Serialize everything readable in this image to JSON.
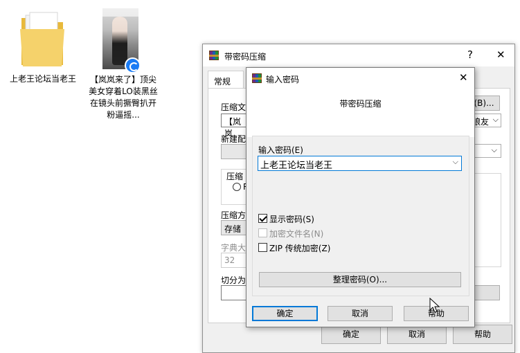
{
  "desktop": {
    "icons": [
      {
        "label": "上老王论坛当老王",
        "type": "folder"
      },
      {
        "label": "【岚岚来了】顶尖美女穿着LO装黑丝在镜头前撅臀扒开粉逼摇...",
        "type": "video"
      }
    ]
  },
  "back_dialog": {
    "title": "带密码压缩",
    "help_btn": "?",
    "close_btn": "✕",
    "tab_general": "常规",
    "archive_name_label": "压缩文",
    "archive_name_value": "【岚岚",
    "browse_btn": "(B)...",
    "format_value": "狼友",
    "new_profile_label": "新建配",
    "compress_group_label": "压缩",
    "radio_label": "R",
    "method_label": "压缩方",
    "method_value": "存储",
    "dict_label": "字典大",
    "dict_value": "32",
    "split_label": "切分为",
    "ok_btn": "确定",
    "cancel_btn": "取消",
    "help_btn_bottom": "帮助"
  },
  "front_dialog": {
    "title": "输入密码",
    "close_btn": "✕",
    "header": "带密码压缩",
    "password_label": "输入密码(E)",
    "password_value": "上老王论坛当老王",
    "show_password": "显示密码(S)",
    "encrypt_filenames": "加密文件名(N)",
    "zip_legacy": "ZIP 传统加密(Z)",
    "organize_btn": "整理密码(O)...",
    "ok_btn": "确定",
    "cancel_btn": "取消",
    "help_btn": "帮助"
  }
}
